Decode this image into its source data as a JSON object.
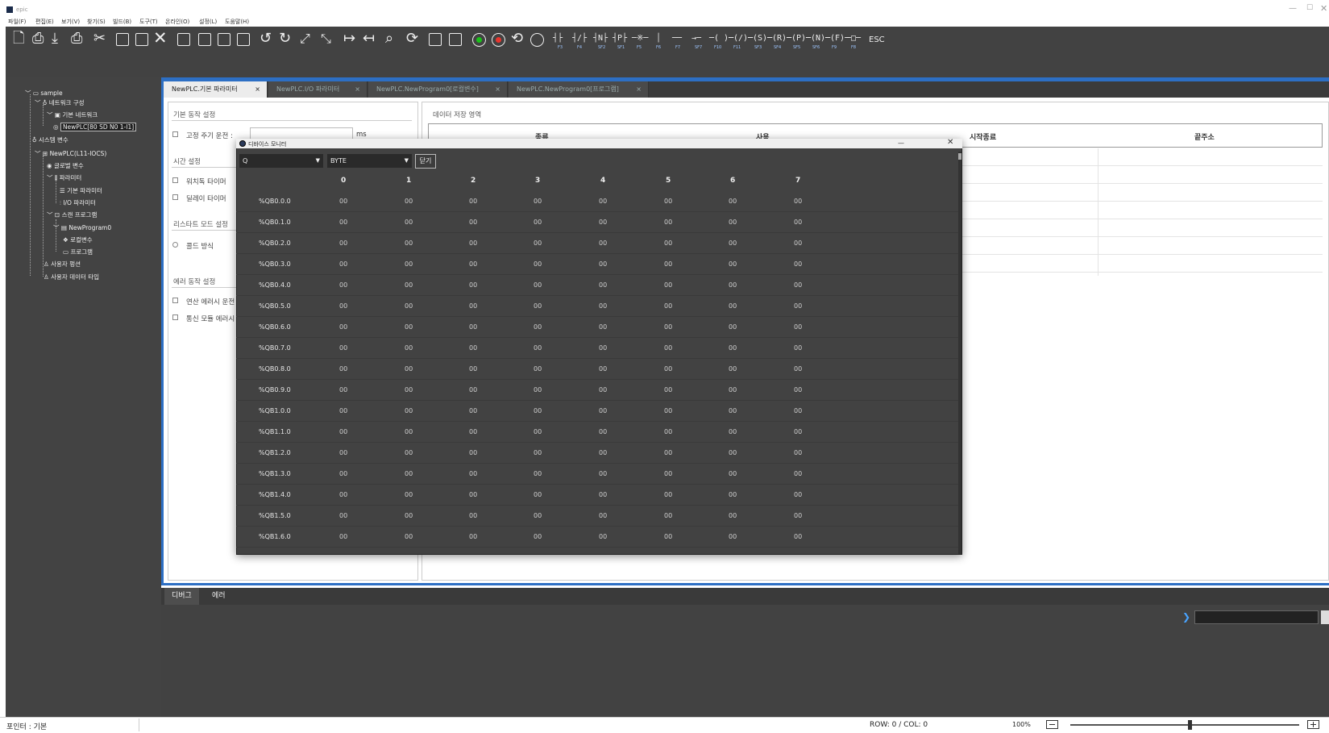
{
  "app": {
    "title": "epic",
    "window_controls": [
      "—",
      "☐",
      "✕"
    ]
  },
  "menu": [
    "파일(F)",
    "편집(E)",
    "보기(V)",
    "찾기(S)",
    "빌드(B)",
    "도구(T)",
    "온라인(O)",
    "설정(L)",
    "도움말(H)"
  ],
  "toolbar": {
    "file_icons": [
      "new-file-icon",
      "open-icon",
      "download-icon",
      "print-icon",
      "cut-icon",
      "copy-icon",
      "paste-icon",
      "delete-icon"
    ],
    "ladder": [
      {
        "symbol": "┤├",
        "key": "F3"
      },
      {
        "symbol": "┤/├",
        "key": "F4"
      },
      {
        "symbol": "┤N├",
        "key": "SF2"
      },
      {
        "symbol": "┤P├",
        "key": "SF1"
      },
      {
        "symbol": "─※─",
        "key": "F5"
      },
      {
        "symbol": "│",
        "key": "F6"
      },
      {
        "symbol": "──",
        "key": "F7"
      },
      {
        "symbol": "→─",
        "key": "SF7"
      },
      {
        "symbol": "─( )─",
        "key": "F10"
      },
      {
        "symbol": "─(/)─",
        "key": "F11"
      },
      {
        "symbol": "─(S)─",
        "key": "SF3"
      },
      {
        "symbol": "─(R)─",
        "key": "SF4"
      },
      {
        "symbol": "─(P)─",
        "key": "SF5"
      },
      {
        "symbol": "─(N)─",
        "key": "SF6"
      },
      {
        "symbol": "─(F)─",
        "key": "F9"
      },
      {
        "symbol": "─□─",
        "key": "F8"
      }
    ],
    "esc_label": "ESC",
    "colors": {
      "run_green": "#19c219",
      "stop_red": "#e8352e"
    }
  },
  "tree": {
    "root": "sample",
    "network": "네트워크 구성",
    "basic_network": "기본 네트워크",
    "plc_node": "NewPLC[80 SD N0 1-I1]",
    "system_vars": "시스템 변수",
    "plc": "NewPLC(L11-IOCS)",
    "global_vars": "글로벌 변수",
    "params": "파라미터",
    "basic_params": "기본 파라미터",
    "io_params": "I/O 파라미터",
    "scan_program": "스캔 프로그램",
    "new_program": "NewProgram0",
    "local_vars": "로컬변수",
    "program": "프로그램",
    "user_func": "사용자 펑션",
    "user_data_type": "사용자 데이터 타입"
  },
  "tabs": [
    {
      "label": "NewPLC.기본 파라미터",
      "active": true
    },
    {
      "label": "NewPLC.I/O 파라미터",
      "active": false
    },
    {
      "label": "NewPLC.NewProgram0[로컬변수]",
      "active": false
    },
    {
      "label": "NewPLC.NewProgram0[프로그램]",
      "active": false
    }
  ],
  "tab_close": "×",
  "params": {
    "basic_section": "기본 동작 설정",
    "fixed_cycle": "고정 주기 운전 :",
    "ms": "ms",
    "time_section": "시간 설정",
    "watchdog": "워치독 타이머",
    "delay": "딜레이 타이머",
    "restart_section": "리스타트 모드 설정",
    "cold": "콜드 방식",
    "error_section": "에러 동작 설정",
    "op_error": "연산 에러시 운전",
    "comm_error": "통신 모듈 에러시"
  },
  "data_area": {
    "title": "데이터 저장 영역",
    "headers": [
      "종류",
      "사용",
      "시작종료",
      "끝주소"
    ]
  },
  "monitor": {
    "title": "디바이스 모니터",
    "device": "Q",
    "type": "BYTE",
    "close_button": "닫기",
    "columns": [
      "0",
      "1",
      "2",
      "3",
      "4",
      "5",
      "6",
      "7"
    ],
    "rows": [
      {
        "addr": "%QB0.0.0",
        "values": [
          "00",
          "00",
          "00",
          "00",
          "00",
          "00",
          "00",
          "00"
        ]
      },
      {
        "addr": "%QB0.1.0",
        "values": [
          "00",
          "00",
          "00",
          "00",
          "00",
          "00",
          "00",
          "00"
        ]
      },
      {
        "addr": "%QB0.2.0",
        "values": [
          "00",
          "00",
          "00",
          "00",
          "00",
          "00",
          "00",
          "00"
        ]
      },
      {
        "addr": "%QB0.3.0",
        "values": [
          "00",
          "00",
          "00",
          "00",
          "00",
          "00",
          "00",
          "00"
        ]
      },
      {
        "addr": "%QB0.4.0",
        "values": [
          "00",
          "00",
          "00",
          "00",
          "00",
          "00",
          "00",
          "00"
        ]
      },
      {
        "addr": "%QB0.5.0",
        "values": [
          "00",
          "00",
          "00",
          "00",
          "00",
          "00",
          "00",
          "00"
        ]
      },
      {
        "addr": "%QB0.6.0",
        "values": [
          "00",
          "00",
          "00",
          "00",
          "00",
          "00",
          "00",
          "00"
        ]
      },
      {
        "addr": "%QB0.7.0",
        "values": [
          "00",
          "00",
          "00",
          "00",
          "00",
          "00",
          "00",
          "00"
        ]
      },
      {
        "addr": "%QB0.8.0",
        "values": [
          "00",
          "00",
          "00",
          "00",
          "00",
          "00",
          "00",
          "00"
        ]
      },
      {
        "addr": "%QB0.9.0",
        "values": [
          "00",
          "00",
          "00",
          "00",
          "00",
          "00",
          "00",
          "00"
        ]
      },
      {
        "addr": "%QB1.0.0",
        "values": [
          "00",
          "00",
          "00",
          "00",
          "00",
          "00",
          "00",
          "00"
        ]
      },
      {
        "addr": "%QB1.1.0",
        "values": [
          "00",
          "00",
          "00",
          "00",
          "00",
          "00",
          "00",
          "00"
        ]
      },
      {
        "addr": "%QB1.2.0",
        "values": [
          "00",
          "00",
          "00",
          "00",
          "00",
          "00",
          "00",
          "00"
        ]
      },
      {
        "addr": "%QB1.3.0",
        "values": [
          "00",
          "00",
          "00",
          "00",
          "00",
          "00",
          "00",
          "00"
        ]
      },
      {
        "addr": "%QB1.4.0",
        "values": [
          "00",
          "00",
          "00",
          "00",
          "00",
          "00",
          "00",
          "00"
        ]
      },
      {
        "addr": "%QB1.5.0",
        "values": [
          "00",
          "00",
          "00",
          "00",
          "00",
          "00",
          "00",
          "00"
        ]
      },
      {
        "addr": "%QB1.6.0",
        "values": [
          "00",
          "00",
          "00",
          "00",
          "00",
          "00",
          "00",
          "00"
        ]
      }
    ]
  },
  "bottom_tabs": [
    {
      "label": "디버그",
      "active": true
    },
    {
      "label": "에러",
      "active": false
    }
  ],
  "status": {
    "left": "포인터 : 기본",
    "rowcol": "ROW: 0 / COL: 0",
    "zoom": "100%",
    "zoom_level": 0.52
  }
}
